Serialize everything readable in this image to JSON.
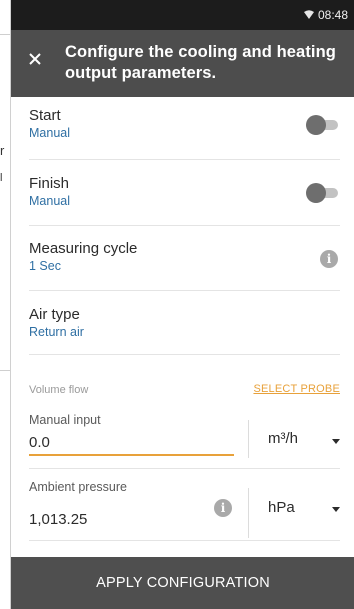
{
  "status_bar": {
    "time": "08:48",
    "wifi_icon": "wifi-icon"
  },
  "header": {
    "title": "Configure the cooling and heating output parameters.",
    "close_icon": "close-icon"
  },
  "background_fragments": [
    "r",
    "l"
  ],
  "settings": [
    {
      "label": "Start",
      "value": "Manual",
      "control": "toggle",
      "on": false
    },
    {
      "label": "Finish",
      "value": "Manual",
      "control": "toggle",
      "on": false
    },
    {
      "label": "Measuring cycle",
      "value": "1 Sec",
      "control": "info-icon"
    },
    {
      "label": "Air type",
      "value": "Return air"
    }
  ],
  "volume_flow": {
    "section_label": "Volume flow",
    "select_probe": "SELECT PROBE",
    "manual_input": {
      "label": "Manual input",
      "value": "0.0",
      "unit": "m³/h"
    },
    "ambient_pressure": {
      "label": "Ambient pressure",
      "value": "1,013.25",
      "unit": "hPa"
    }
  },
  "apply_button": "APPLY CONFIGURATION",
  "colors": {
    "header_bg": "#4d4d4d",
    "accent": "#e8a13a",
    "value_blue": "#2f6fa3",
    "button_bg": "#4f4f4f"
  }
}
